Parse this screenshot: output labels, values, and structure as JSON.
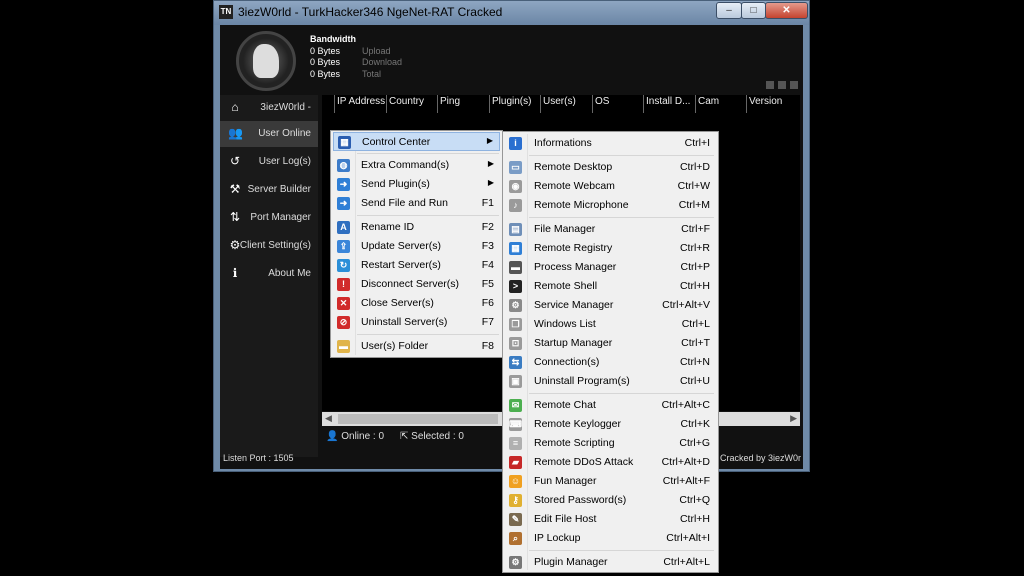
{
  "window": {
    "icon_text": "TN",
    "title": "3iezW0rld - TurkHacker346 NgeNet-RAT Cracked",
    "min": "–",
    "max": "□",
    "close": "✕"
  },
  "bandwidth": {
    "title": "Bandwidth",
    "rows": [
      {
        "value": "0 Bytes",
        "label": "Upload"
      },
      {
        "value": "0 Bytes",
        "label": "Download"
      },
      {
        "value": "0 Bytes",
        "label": "Total"
      }
    ]
  },
  "sidebar": {
    "items": [
      {
        "label": "3iezW0rld -",
        "icon": "home-icon",
        "glyph": "⌂"
      },
      {
        "label": "User Online",
        "icon": "users-icon",
        "glyph": "👥"
      },
      {
        "label": "User Log(s)",
        "icon": "history-icon",
        "glyph": "↺"
      },
      {
        "label": "Server Builder",
        "icon": "tools-icon",
        "glyph": "⚒"
      },
      {
        "label": "Port Manager",
        "icon": "port-icon",
        "glyph": "⇅"
      },
      {
        "label": "Client Setting(s)",
        "icon": "gear-icon",
        "glyph": "⚙"
      },
      {
        "label": "About Me",
        "icon": "info-icon",
        "glyph": "ℹ"
      }
    ]
  },
  "grid": {
    "columns": [
      "IP Address",
      "Country",
      "Ping",
      "Plugin(s)",
      "User(s)",
      "OS",
      "Install D...",
      "Cam",
      "Version"
    ]
  },
  "status": {
    "online": "Online : 0",
    "selected": "Selected : 0",
    "listen_port": "Listen Port : 1505",
    "cracked_by": "Cracked by 3iezW0r"
  },
  "context_menu": {
    "items": [
      {
        "label": "Control Center",
        "shortcut": "",
        "submenu": true,
        "icon": "control-center-icon",
        "color": "#2a5db0",
        "glyph": "▦"
      },
      {
        "label": "Extra Command(s)",
        "shortcut": "",
        "submenu": true,
        "icon": "globe-icon",
        "color": "#3d7cc9",
        "glyph": "◍"
      },
      {
        "label": "Send Plugin(s)",
        "shortcut": "",
        "submenu": true,
        "icon": "arrow-right-icon",
        "color": "#2f7fd6",
        "glyph": "➜"
      },
      {
        "label": "Send File and Run",
        "shortcut": "F1",
        "submenu": false,
        "icon": "send-file-icon",
        "color": "#2f7fd6",
        "glyph": "➜"
      },
      {
        "label": "Rename ID",
        "shortcut": "F2",
        "submenu": false,
        "icon": "rename-icon",
        "color": "#2f6fc0",
        "glyph": "A"
      },
      {
        "label": "Update Server(s)",
        "shortcut": "F3",
        "submenu": false,
        "icon": "update-icon",
        "color": "#3b86d9",
        "glyph": "⇪"
      },
      {
        "label": "Restart Server(s)",
        "shortcut": "F4",
        "submenu": false,
        "icon": "restart-icon",
        "color": "#2b8fd8",
        "glyph": "↻"
      },
      {
        "label": "Disconnect Server(s)",
        "shortcut": "F5",
        "submenu": false,
        "icon": "disconnect-icon",
        "color": "#d12b2b",
        "glyph": "!"
      },
      {
        "label": "Close Server(s)",
        "shortcut": "F6",
        "submenu": false,
        "icon": "close-server-icon",
        "color": "#d12b2b",
        "glyph": "✕"
      },
      {
        "label": "Uninstall Server(s)",
        "shortcut": "F7",
        "submenu": false,
        "icon": "uninstall-icon",
        "color": "#d12b2b",
        "glyph": "⊘"
      },
      {
        "label": "User(s) Folder",
        "shortcut": "F8",
        "submenu": false,
        "icon": "folder-icon",
        "color": "#e0b44a",
        "glyph": "▬"
      }
    ]
  },
  "control_center_menu": {
    "items": [
      {
        "label": "Informations",
        "shortcut": "Ctrl+I",
        "icon": "info-icon",
        "color": "#2a6fd0",
        "glyph": "i"
      },
      {
        "label": "Remote Desktop",
        "shortcut": "Ctrl+D",
        "icon": "desktop-icon",
        "color": "#7a9cc6",
        "glyph": "▭"
      },
      {
        "label": "Remote Webcam",
        "shortcut": "Ctrl+W",
        "icon": "webcam-icon",
        "color": "#9a9a9a",
        "glyph": "◉"
      },
      {
        "label": "Remote Microphone",
        "shortcut": "Ctrl+M",
        "icon": "microphone-icon",
        "color": "#9a9a9a",
        "glyph": "♪"
      },
      {
        "label": "File Manager",
        "shortcut": "Ctrl+F",
        "icon": "file-manager-icon",
        "color": "#6f8fb8",
        "glyph": "▤"
      },
      {
        "label": "Remote Registry",
        "shortcut": "Ctrl+R",
        "icon": "registry-icon",
        "color": "#2f7fd6",
        "glyph": "▦"
      },
      {
        "label": "Process Manager",
        "shortcut": "Ctrl+P",
        "icon": "process-icon",
        "color": "#555555",
        "glyph": "▬"
      },
      {
        "label": "Remote Shell",
        "shortcut": "Ctrl+H",
        "icon": "shell-icon",
        "color": "#222222",
        "glyph": ">"
      },
      {
        "label": "Service Manager",
        "shortcut": "Ctrl+Alt+V",
        "icon": "service-gear-icon",
        "color": "#8a8a8a",
        "glyph": "⚙"
      },
      {
        "label": "Windows List",
        "shortcut": "Ctrl+L",
        "icon": "windows-list-icon",
        "color": "#9a9a9a",
        "glyph": "❐"
      },
      {
        "label": "Startup Manager",
        "shortcut": "Ctrl+T",
        "icon": "startup-icon",
        "color": "#9a9a9a",
        "glyph": "⊡"
      },
      {
        "label": "Connection(s)",
        "shortcut": "Ctrl+N",
        "icon": "connection-icon",
        "color": "#3a7cc2",
        "glyph": "⇆"
      },
      {
        "label": "Uninstall Program(s)",
        "shortcut": "Ctrl+U",
        "icon": "uninstall-program-icon",
        "color": "#9a9a9a",
        "glyph": "▣"
      },
      {
        "label": "Remote Chat",
        "shortcut": "Ctrl+Alt+C",
        "icon": "chat-icon",
        "color": "#4caf50",
        "glyph": "✉"
      },
      {
        "label": "Remote Keylogger",
        "shortcut": "Ctrl+K",
        "icon": "keyboard-icon",
        "color": "#9a9a9a",
        "glyph": "⌨"
      },
      {
        "label": "Remote Scripting",
        "shortcut": "Ctrl+G",
        "icon": "script-icon",
        "color": "#b0b0b0",
        "glyph": "≡"
      },
      {
        "label": "Remote DDoS Attack",
        "shortcut": "Ctrl+Alt+D",
        "icon": "ddos-icon",
        "color": "#c62828",
        "glyph": "▰"
      },
      {
        "label": "Fun Manager",
        "shortcut": "Ctrl+Alt+F",
        "icon": "smiley-icon",
        "color": "#f0a020",
        "glyph": "☺"
      },
      {
        "label": "Stored Password(s)",
        "shortcut": "Ctrl+Q",
        "icon": "key-icon",
        "color": "#e0b030",
        "glyph": "⚷"
      },
      {
        "label": "Edit File Host",
        "shortcut": "Ctrl+H",
        "icon": "edit-icon",
        "color": "#7a6a50",
        "glyph": "✎"
      },
      {
        "label": "IP Lockup",
        "shortcut": "Ctrl+Alt+I",
        "icon": "ip-lookup-icon",
        "color": "#b07030",
        "glyph": "⌕"
      },
      {
        "label": "Plugin Manager",
        "shortcut": "Ctrl+Alt+L",
        "icon": "plugin-gear-icon",
        "color": "#777777",
        "glyph": "⚙"
      }
    ]
  }
}
